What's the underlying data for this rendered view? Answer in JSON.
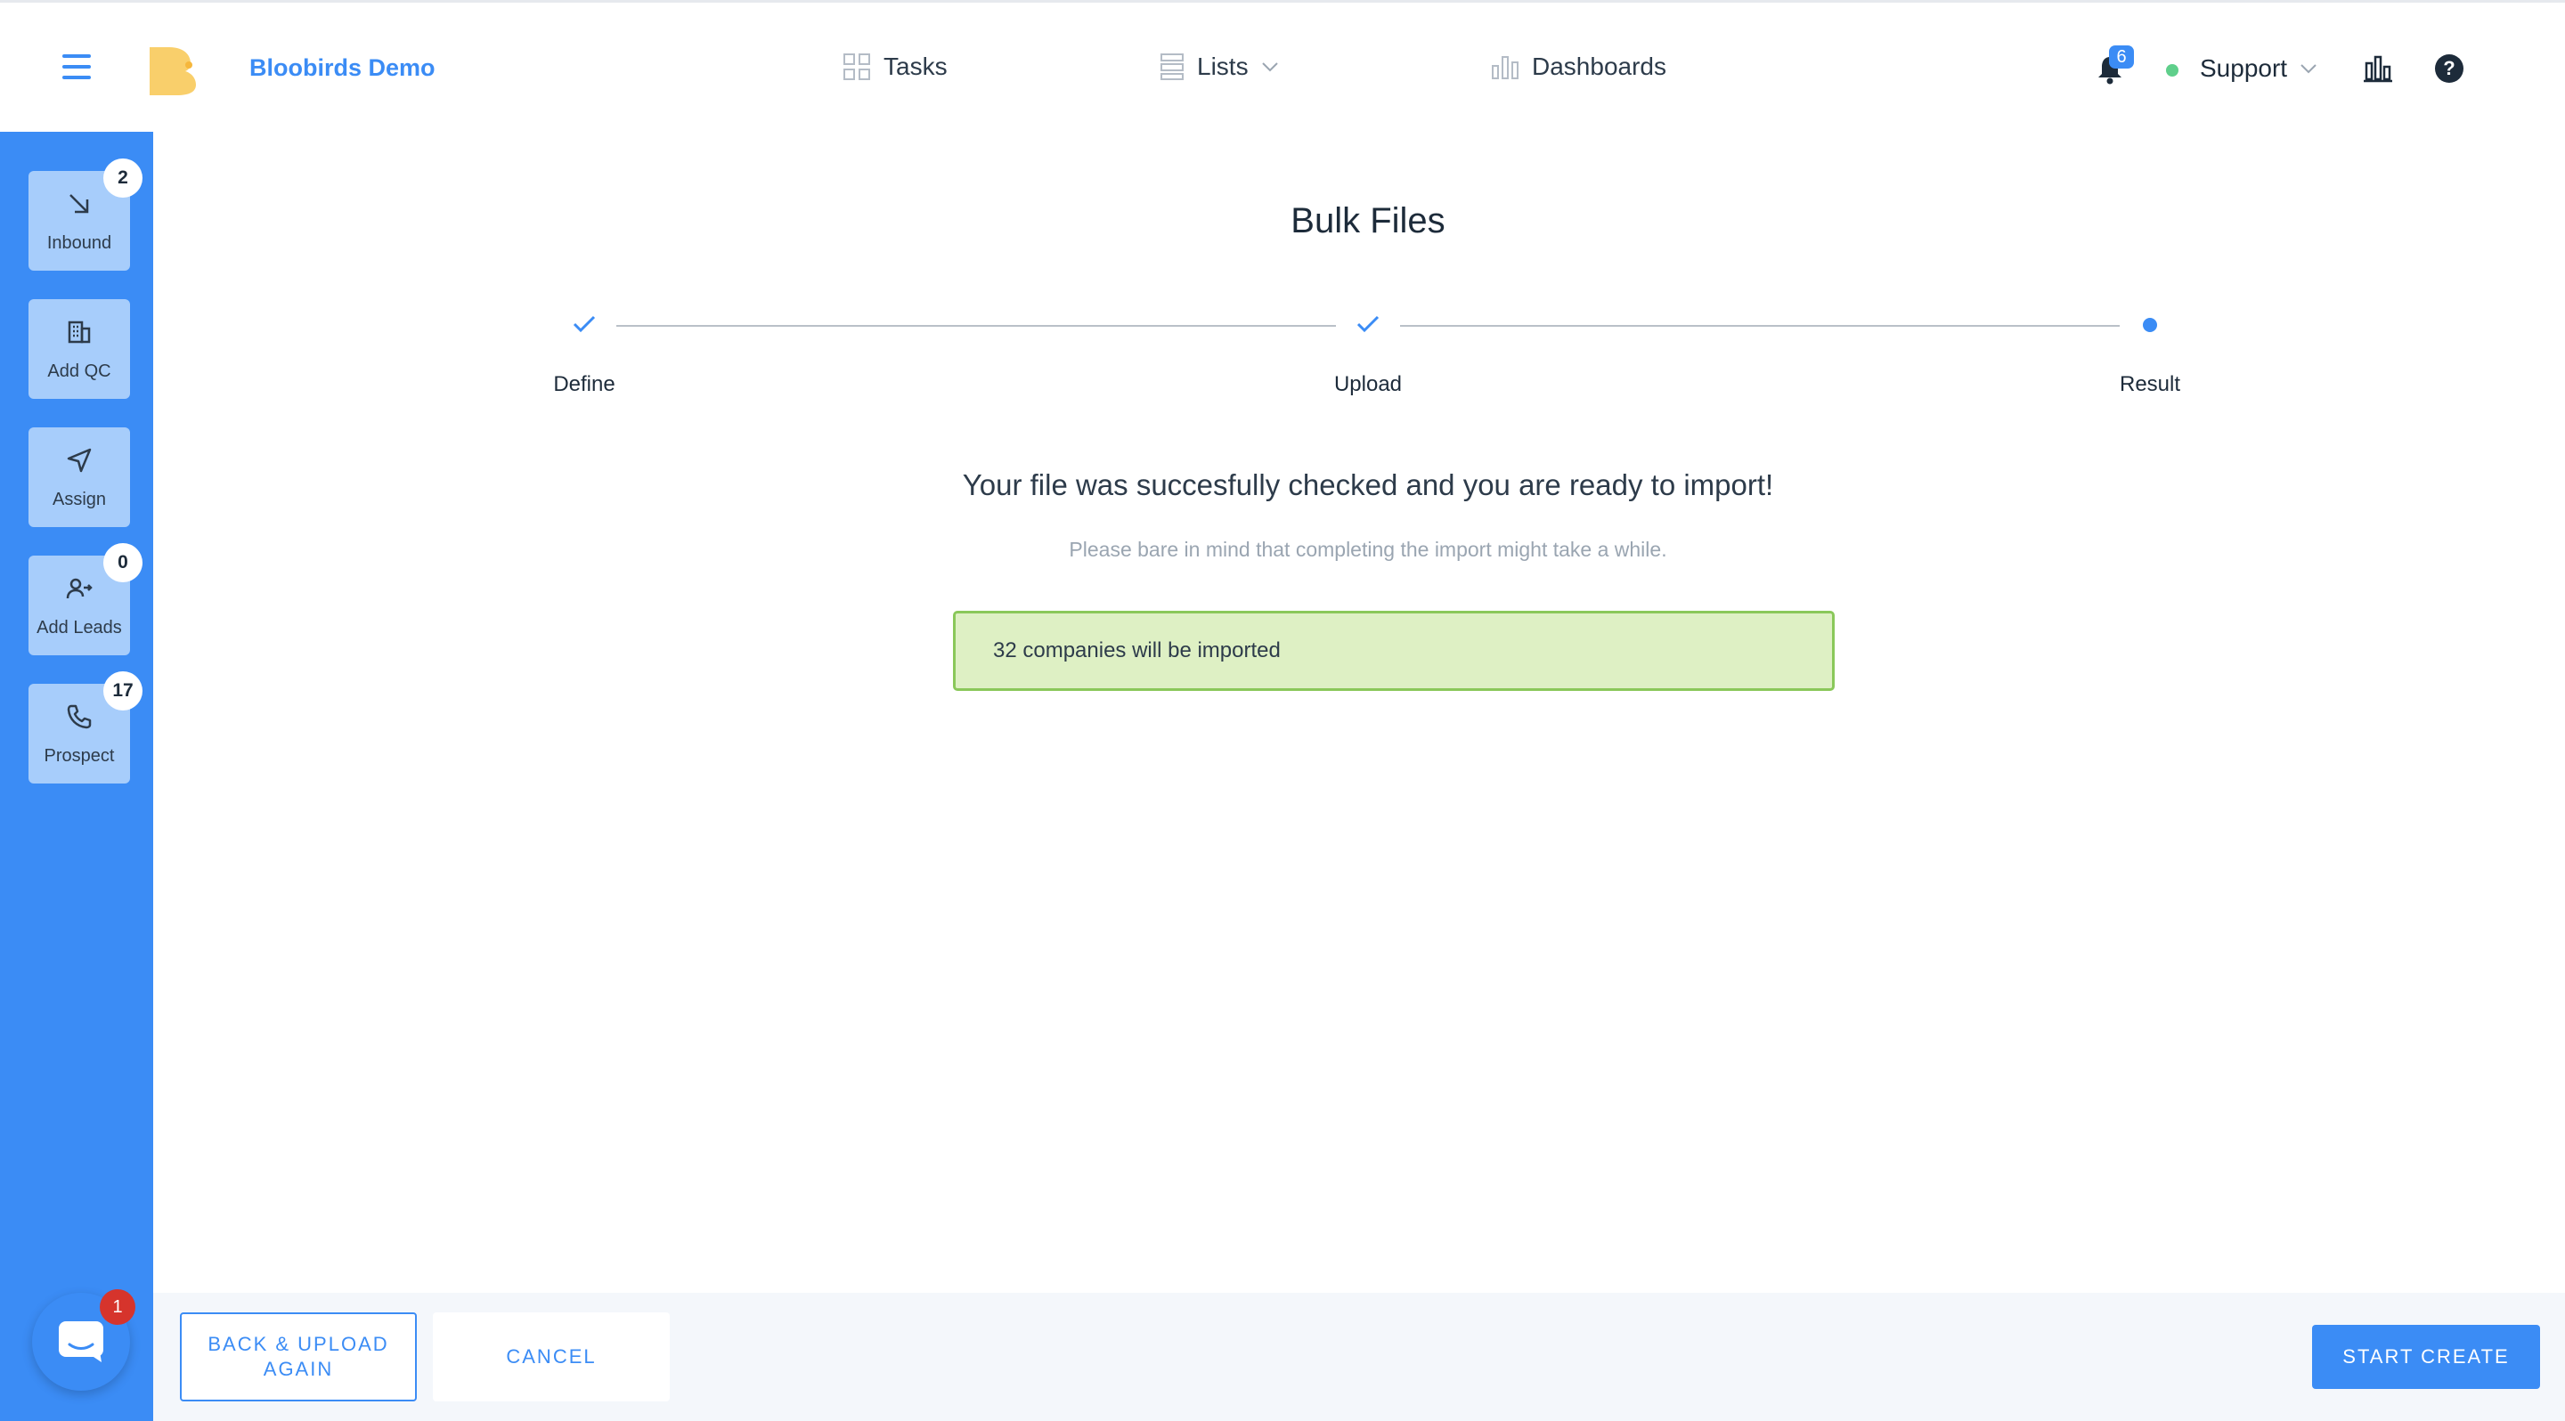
{
  "header": {
    "brand": "Bloobirds Demo",
    "nav": [
      {
        "label": "Tasks",
        "icon": "grid-icon"
      },
      {
        "label": "Lists",
        "icon": "list-icon"
      },
      {
        "label": "Dashboards",
        "icon": "bar-chart-icon"
      }
    ],
    "notifications_count": "6",
    "user_menu_label": "Support"
  },
  "sidebar": {
    "items": [
      {
        "label": "Inbound",
        "badge": "2",
        "icon": "arrow-down-right-icon"
      },
      {
        "label": "Add QC",
        "badge": null,
        "icon": "building-icon"
      },
      {
        "label": "Assign",
        "badge": null,
        "icon": "send-icon"
      },
      {
        "label": "Add Leads",
        "badge": "0",
        "icon": "add-user-icon"
      },
      {
        "label": "Prospect",
        "badge": "17",
        "icon": "phone-icon"
      }
    ],
    "chat_badge": "1"
  },
  "main": {
    "title": "Bulk Files",
    "steps": [
      {
        "label": "Define",
        "state": "done"
      },
      {
        "label": "Upload",
        "state": "done"
      },
      {
        "label": "Result",
        "state": "current"
      }
    ],
    "headline": "Your file was succesfully checked and you are ready to import!",
    "subline": "Please bare in mind that completing the import might take a while.",
    "notice": "32 companies will be imported"
  },
  "footer": {
    "back_label": "BACK & UPLOAD AGAIN",
    "cancel_label": "CANCEL",
    "start_label": "START CREATE"
  },
  "colors": {
    "accent": "#3b8cf5",
    "sidebar_button": "#a7cdfb",
    "success_bg": "#def0c4",
    "success_border": "#8ac85a",
    "chat_badge": "#d6342c"
  }
}
